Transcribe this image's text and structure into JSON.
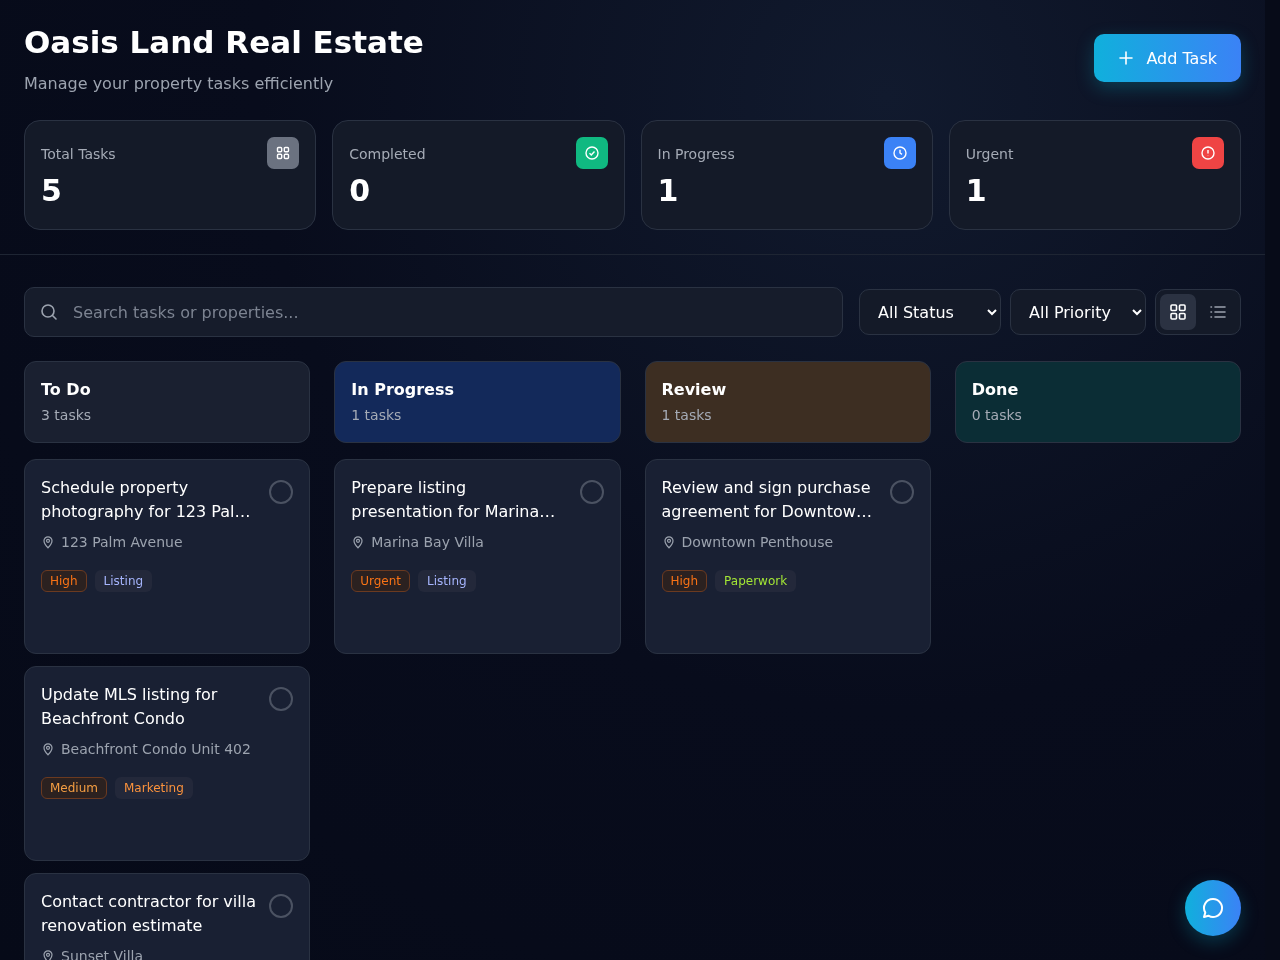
{
  "header": {
    "title": "Oasis Land Real Estate",
    "subtitle": "Manage your property tasks efficiently",
    "add_button": "Add Task"
  },
  "stats": [
    {
      "label": "Total Tasks",
      "value": "5",
      "kind": "grid",
      "color": "#6b7280"
    },
    {
      "label": "Completed",
      "value": "0",
      "kind": "check",
      "color": "#10b981"
    },
    {
      "label": "In Progress",
      "value": "1",
      "kind": "clock",
      "color": "#3b82f6"
    },
    {
      "label": "Urgent",
      "value": "1",
      "kind": "alert",
      "color": "#ef4444"
    }
  ],
  "toolbar": {
    "search": {
      "placeholder": "Search tasks or properties..."
    },
    "status_filter": "All Status",
    "priority_filter": "All Priority",
    "views": [
      {
        "kind": "grid",
        "selected": true
      },
      {
        "kind": "list",
        "selected": false
      }
    ]
  },
  "columns": [
    {
      "title": "To Do",
      "count": "3 tasks",
      "color": "#1a2030",
      "tasks": [
        {
          "title": "Schedule property photography for 123 Pal…",
          "property": "123 Palm Avenue",
          "checked": false,
          "tags": [
            {
              "kind": "priority",
              "label": "High",
              "color": "#f97316"
            },
            {
              "kind": "category",
              "label": "Listing",
              "color": "#a5b4fc"
            }
          ]
        },
        {
          "title": "Update MLS listing for Beachfront Condo",
          "property": "Beachfront Condo Unit 402",
          "checked": false,
          "tags": [
            {
              "kind": "priority",
              "label": "Medium",
              "color": "#f59e42"
            },
            {
              "kind": "category",
              "label": "Marketing",
              "color": "#fb923c"
            }
          ]
        },
        {
          "title": "Contact contractor for villa renovation estimate",
          "property": "Sunset Villa",
          "checked": false
        }
      ]
    },
    {
      "title": "In Progress",
      "count": "1 tasks",
      "color": "#13295a",
      "tasks": [
        {
          "title": "Prepare listing presentation for Marina…",
          "property": "Marina Bay Villa",
          "checked": false,
          "tags": [
            {
              "kind": "priority",
              "label": "Urgent",
              "color": "#f97316"
            },
            {
              "kind": "category",
              "label": "Listing",
              "color": "#a5b4fc"
            }
          ]
        }
      ]
    },
    {
      "title": "Review",
      "count": "1 tasks",
      "color": "#3d2e22",
      "tasks": [
        {
          "title": "Review and sign purchase agreement for Downtow…",
          "property": "Downtown Penthouse",
          "checked": false,
          "tags": [
            {
              "kind": "priority",
              "label": "High",
              "color": "#f97316"
            },
            {
              "kind": "category",
              "label": "Paperwork",
              "color": "#a3e635"
            }
          ]
        }
      ]
    },
    {
      "title": "Done",
      "count": "0 tasks",
      "color": "#0b2d35"
    }
  ]
}
